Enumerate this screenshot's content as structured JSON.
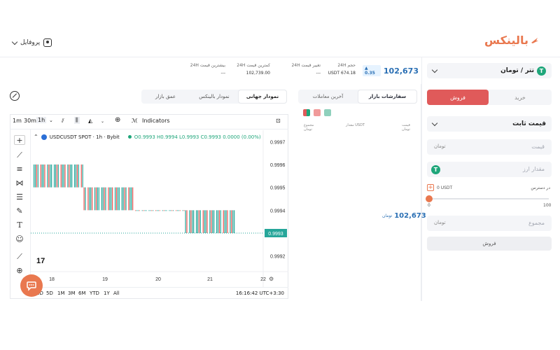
{
  "brand": {
    "name": "بالینکس",
    "color": "#e9784f"
  },
  "profile": {
    "label": "پروفایل"
  },
  "market": {
    "pair": "تتر / تومان",
    "price": "102,673",
    "price_unit": "تومان",
    "change": "0.35",
    "stats": [
      {
        "label": "حجم 24H",
        "value": "USDT 674.18"
      },
      {
        "label": "تغییر قیمت 24H",
        "value": "---"
      },
      {
        "label": "کمترین قیمت 24H",
        "value": "102,739.00"
      },
      {
        "label": "بیشترین قیمت 24H",
        "value": "---"
      }
    ]
  },
  "trade": {
    "buy_tab": "خرید",
    "sell_tab": "فروش",
    "order_type": "قیمت ثابت",
    "price_placeholder": "قیمت",
    "amount_placeholder": "مقدار ارز",
    "total_placeholder": "مجموع",
    "toman_unit": "تومان",
    "balance_label": "0 USDT",
    "balance_title": "در دسترس",
    "slider_min": "0",
    "slider_max": "100",
    "slider_value": 0,
    "submit": "فروش"
  },
  "orderbook": {
    "tabs": [
      "سفارشات بازار",
      "آخرین معاملات"
    ],
    "headers": [
      "قیمت",
      "مقدار USDT",
      "مجموع"
    ],
    "header_units": [
      "تومان",
      "",
      "تومان"
    ],
    "last_price": "102,673",
    "last_price_unit": "تومان"
  },
  "chart_tabs": [
    "نمودار جهانی",
    "نمودار بالینکس",
    "عمق بازار"
  ],
  "chart_toolbar": {
    "intervals": [
      "1m",
      "30m",
      "1h"
    ],
    "indicators": "Indicators"
  },
  "chart_data": {
    "type": "candlestick",
    "symbol_line": "USDCUSDT SPOT · 1h · Bybit",
    "ohlc_line": "O0.9993 H0.9994 L0.9993 C0.9993 0.0000 (0.00%)",
    "x_ticks": [
      "18",
      "19",
      "20",
      "21",
      "22"
    ],
    "y_ticks": [
      "0.9997",
      "0.9996",
      "0.9995",
      "0.9994",
      "0.9993",
      "0.9992"
    ],
    "ylim": [
      0.99915,
      0.99975
    ],
    "last_price_label": "0.9993",
    "candles_close_pattern": [
      0.9996,
      0.9995,
      0.9994,
      0.9994,
      0.9993
    ]
  },
  "chart_bottom": {
    "ranges": [
      "1D",
      "5D",
      "1M",
      "3M",
      "6M",
      "YTD",
      "1Y",
      "All"
    ],
    "time": "16:16:42 UTC+3:30"
  }
}
